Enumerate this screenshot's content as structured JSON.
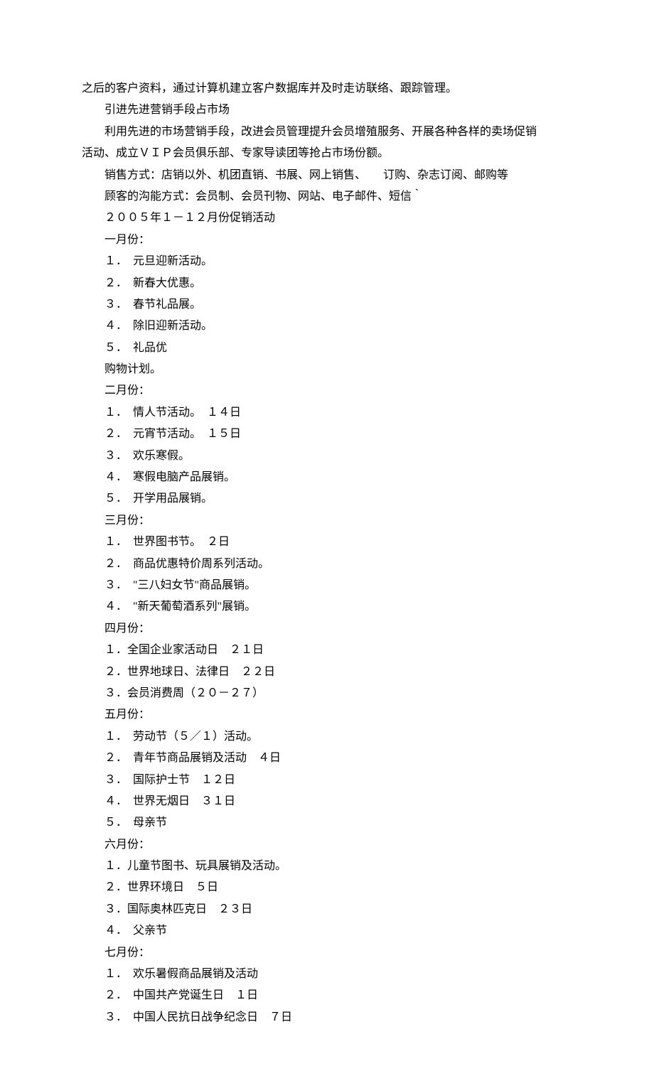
{
  "lines": [
    {
      "cls": "para",
      "text": "之后的客户资料，通过计算机建立客户数据库并及时走访联络、跟踪管理。"
    },
    {
      "cls": "para indent1",
      "text": "引进先进营销手段占市场"
    },
    {
      "cls": "para indent1",
      "text": "利用先进的市场营销手段，改进会员管理提升会员增殖服务、开展各种各样的卖场促销"
    },
    {
      "cls": "para",
      "text": "活动、成立ＶＩＰ会员俱乐部、专家导读团等抢占市场份额。"
    },
    {
      "cls": "para indent1",
      "text": "销售方式：店销以外、机团直销、书展、网上销售、　　订购、杂志订阅、邮购等"
    },
    {
      "cls": "para indent1",
      "text": "顾客的沟能方式：会员制、会员刊物、网站、电子邮件、短信｀"
    },
    {
      "cls": "para indent1",
      "text": "２００５年１－１２月份促销活动"
    },
    {
      "cls": "para indent1",
      "text": "一月份："
    },
    {
      "cls": "para indent1",
      "text": "１．　元旦迎新活动。"
    },
    {
      "cls": "para indent1",
      "text": "２．　新春大优惠。"
    },
    {
      "cls": "para indent1",
      "text": "３．　春节礼品展。"
    },
    {
      "cls": "para indent1",
      "text": "４．　除旧迎新活动。"
    },
    {
      "cls": "para indent1",
      "text": "５．　礼品优"
    },
    {
      "cls": "para indent1",
      "text": "购物计划。"
    },
    {
      "cls": "para indent1",
      "text": "二月份："
    },
    {
      "cls": "para indent1",
      "text": "１．　情人节活动。　１４日"
    },
    {
      "cls": "para indent1",
      "text": "２．　元宵节活动。　１５日"
    },
    {
      "cls": "para indent1",
      "text": "３．　欢乐寒假。"
    },
    {
      "cls": "para indent1",
      "text": "４．　寒假电脑产品展销。"
    },
    {
      "cls": "para indent1",
      "text": "５．　开学用品展销。"
    },
    {
      "cls": "para indent1",
      "text": "三月份："
    },
    {
      "cls": "para indent1",
      "text": "１．　世界图书节。　２日"
    },
    {
      "cls": "para indent1",
      "text": "２．　商品优惠特价周系列活动。"
    },
    {
      "cls": "para indent1",
      "text": "３．　\"三八妇女节\"商品展销。"
    },
    {
      "cls": "para indent1",
      "text": "４．　\"新天葡萄酒系列\"展销。"
    },
    {
      "cls": "para indent1",
      "text": "四月份："
    },
    {
      "cls": "para indent1",
      "text": "１．全国企业家活动日　２１日"
    },
    {
      "cls": "para indent1",
      "text": "２．世界地球日、法律日　２２日"
    },
    {
      "cls": "para indent1",
      "text": "３．会员消费周（２０－２７）"
    },
    {
      "cls": "para indent1",
      "text": "五月份："
    },
    {
      "cls": "para indent1",
      "text": "１．　劳动节（５／１）活动。"
    },
    {
      "cls": "para indent1",
      "text": "２．　青年节商品展销及活动　４日"
    },
    {
      "cls": "para indent1",
      "text": "３．　国际护士节　１２日"
    },
    {
      "cls": "para indent1",
      "text": "４．　世界无烟日　３１日"
    },
    {
      "cls": "para indent1",
      "text": "５．　母亲节"
    },
    {
      "cls": "para indent1",
      "text": "六月份："
    },
    {
      "cls": "para indent1",
      "text": "１．儿童节图书、玩具展销及活动。"
    },
    {
      "cls": "para indent1",
      "text": "２．世界环境日　５日"
    },
    {
      "cls": "para indent1",
      "text": "３．国际奥林匹克日　２３日"
    },
    {
      "cls": "para indent1",
      "text": "４．　父亲节"
    },
    {
      "cls": "para indent1",
      "text": "七月份："
    },
    {
      "cls": "para indent1",
      "text": "１．　欢乐暑假商品展销及活动"
    },
    {
      "cls": "para indent1",
      "text": "２．　中国共产党诞生日　１日"
    },
    {
      "cls": "para indent1",
      "text": "３．　中国人民抗日战争纪念日　７日"
    }
  ]
}
